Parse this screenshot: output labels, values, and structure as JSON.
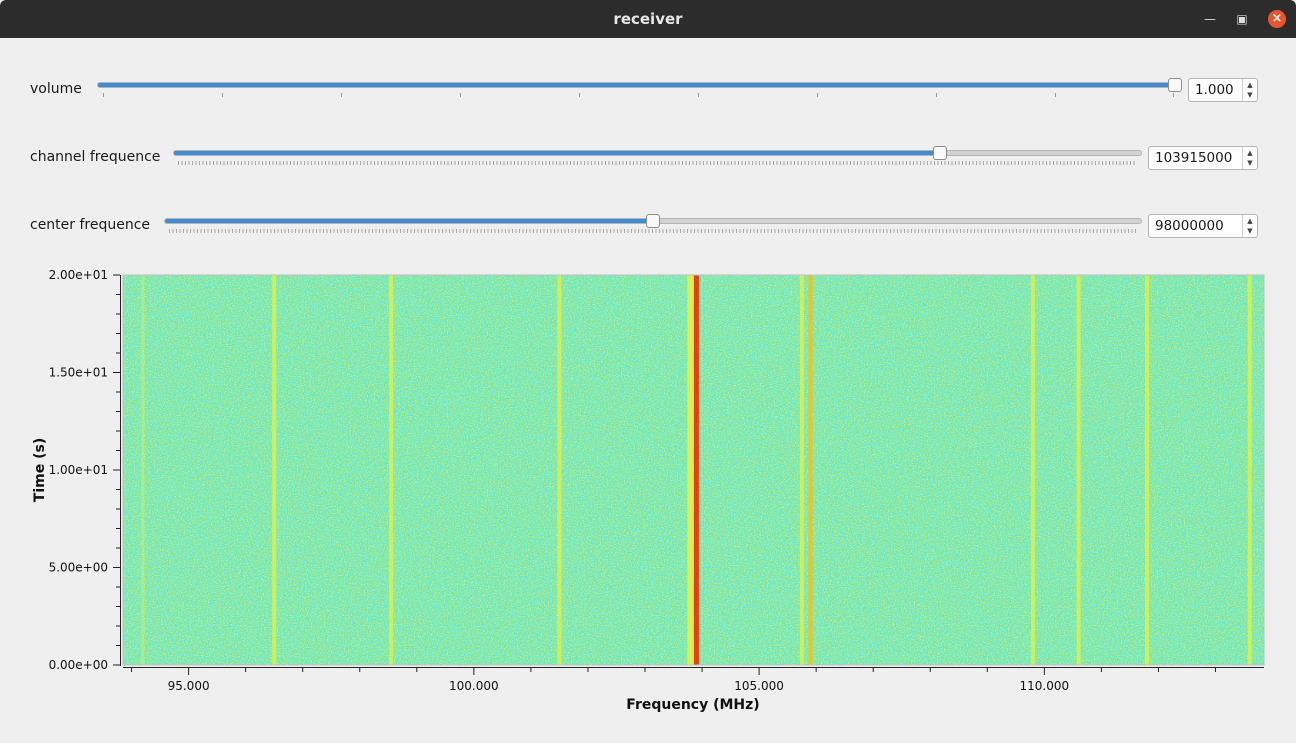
{
  "window": {
    "title": "receiver"
  },
  "controls": {
    "volume": {
      "label": "volume",
      "value": "1.000",
      "fraction": 1.0
    },
    "channel": {
      "label": "channel frequence",
      "value": "103915000",
      "fraction": 0.8
    },
    "center": {
      "label": "center frequence",
      "value": "98000000",
      "fraction": 0.5
    }
  },
  "chart_data": {
    "type": "heatmap",
    "title": "",
    "xlabel": "Frequency (MHz)",
    "ylabel": "Time (s)",
    "xlim": [
      93.85,
      113.85
    ],
    "ylim": [
      0,
      20
    ],
    "x_ticks": [
      "95.000",
      "100.000",
      "105.000",
      "110.000"
    ],
    "y_ticks": [
      "0.00e+00",
      "5.00e+00",
      "1.00e+01",
      "1.50e+01",
      "2.00e+01"
    ],
    "colormap": "rainbow (blue-green-yellow-red)",
    "signal_lines": [
      {
        "freq": 94.2,
        "level": "weak"
      },
      {
        "freq": 96.5,
        "level": "moderate"
      },
      {
        "freq": 98.55,
        "level": "moderate"
      },
      {
        "freq": 101.5,
        "level": "moderate"
      },
      {
        "freq": 103.9,
        "level": "strong"
      },
      {
        "freq": 105.75,
        "level": "moderate"
      },
      {
        "freq": 105.9,
        "level": "strong-yellow"
      },
      {
        "freq": 109.8,
        "level": "moderate"
      },
      {
        "freq": 110.6,
        "level": "moderate"
      },
      {
        "freq": 111.8,
        "level": "moderate"
      },
      {
        "freq": 113.6,
        "level": "moderate"
      }
    ]
  }
}
